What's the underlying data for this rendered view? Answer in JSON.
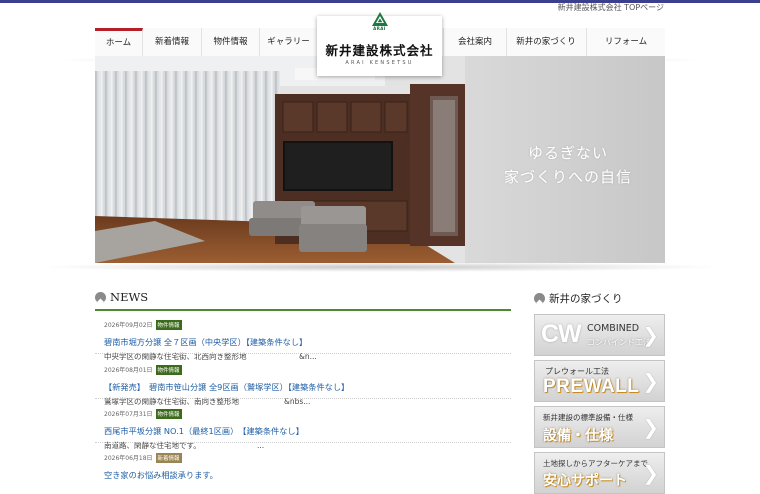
{
  "header": {
    "caption": "新井建設株式会社 TOPページ"
  },
  "logo": {
    "small": "ARAI",
    "title": "新井建設株式会社",
    "subtitle": "ARAI KENSETSU"
  },
  "nav": {
    "left": [
      "ホーム",
      "新着情報",
      "物件情報",
      "ギャラリー"
    ],
    "right": [
      "会社案内",
      "新井の家づくり",
      "リフォーム"
    ]
  },
  "hero": {
    "line1": "ゆるぎない",
    "line2": "家づくりへの自信"
  },
  "news": {
    "title": "NEWS",
    "items": [
      {
        "date": "2026年09月02日",
        "badge": "物件情報",
        "title": "碧南市堀方分譲 全７区画（中央学区）【建築条件なし】",
        "desc": "中央学区の閑静な住宅街、北西向き整形地　　　　　　　&n..."
      },
      {
        "date": "2026年08月01日",
        "badge": "物件情報",
        "title": "【新発売】　碧南市笹山分譲 全9区画（鷲塚学区）【建築条件なし】",
        "desc": "鷲塚学区の閑静な住宅街、南向き整形地　　　　　　&nbs..."
      },
      {
        "date": "2026年07月31日",
        "badge": "物件情報",
        "title": "西尾市平坂分譲 NO.1（最終1区画）　【建築条件なし】",
        "desc": "南道路、閑静な住宅地です。　　　　　　　　..."
      },
      {
        "date": "2026年06月18日",
        "badge": "新着情報",
        "title": "空き家のお悩み相談承ります。",
        "desc": ""
      }
    ]
  },
  "sidebar": {
    "title": "新井の家づくり",
    "banners": [
      {
        "main": "CW",
        "text1": "COMBINED",
        "text2": "コンバインド工法"
      },
      {
        "main": "PREWALL",
        "text1": "プレウォール工法"
      },
      {
        "main": "設備・仕様",
        "text1": "新井建設の標準設備・仕様"
      },
      {
        "text1": "土地探しからアフターケアまで",
        "main": "安心サポート"
      }
    ]
  },
  "colors": {
    "accent_red": "#b41f28",
    "news_green": "#4c8a32",
    "link_blue": "#1f5fa6",
    "top_bar": "#3c3f8c"
  }
}
